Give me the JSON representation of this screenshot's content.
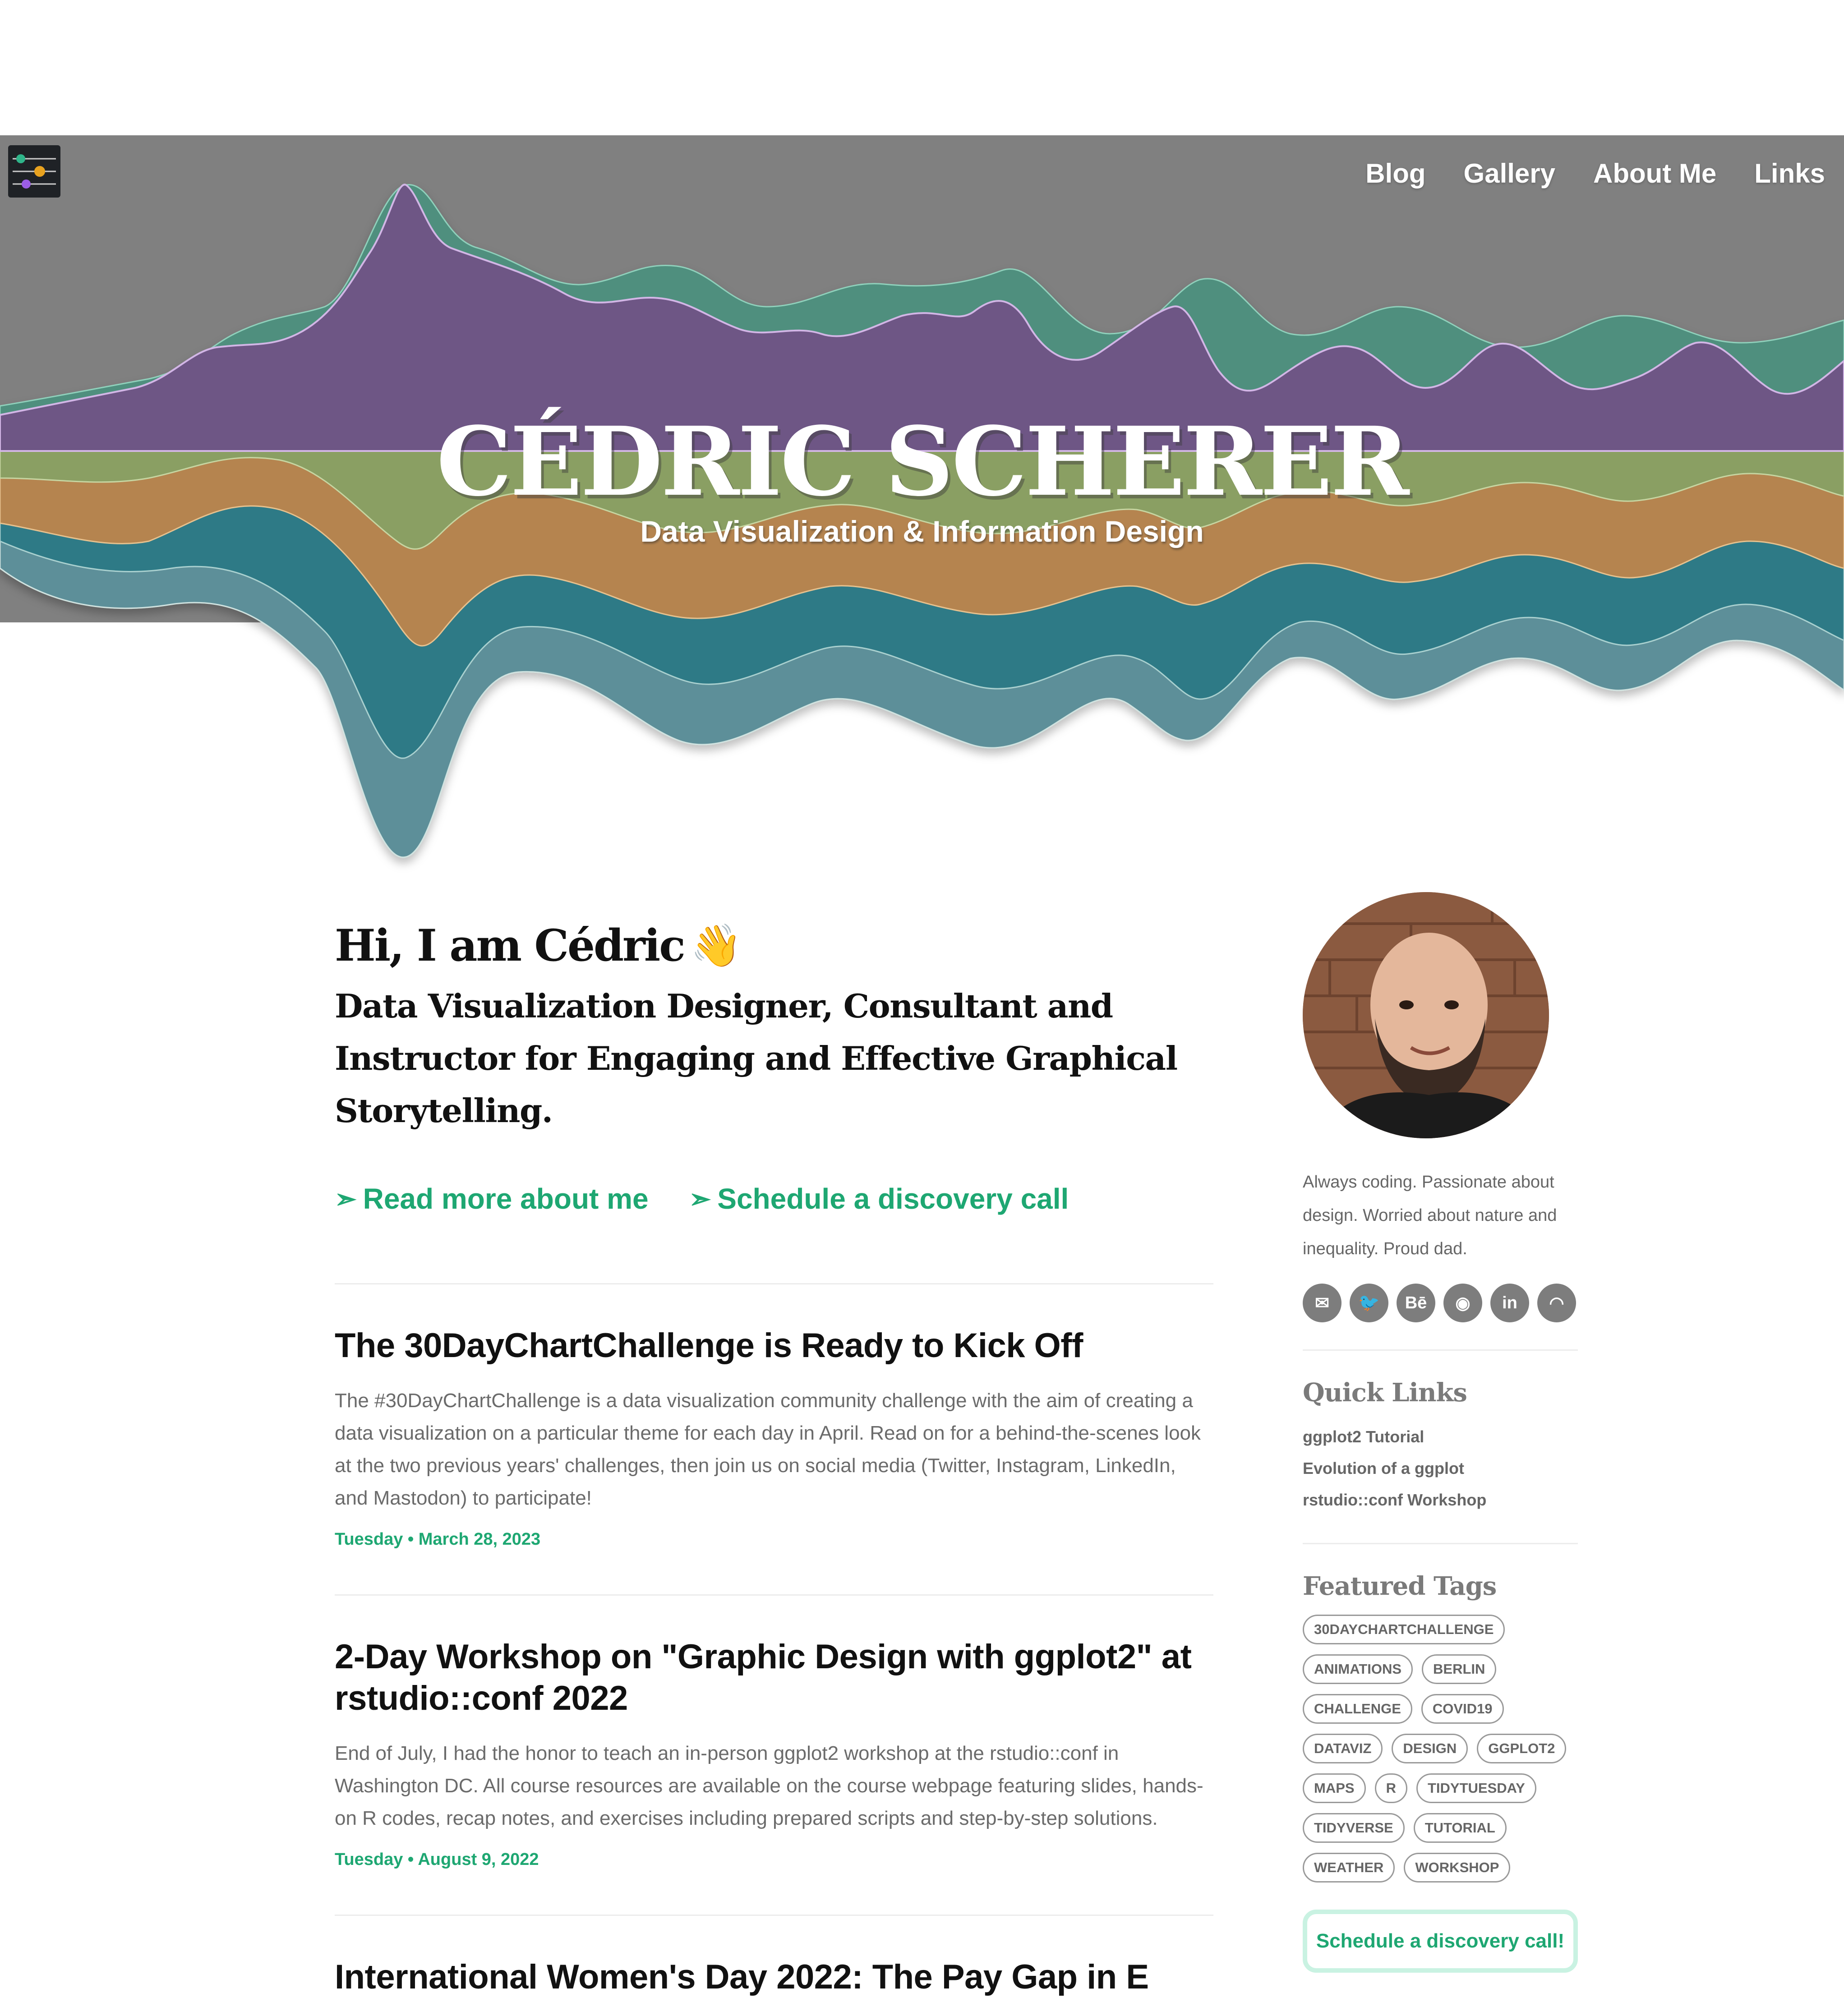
{
  "nav": {
    "items": [
      "Blog",
      "Gallery",
      "About Me",
      "Links"
    ]
  },
  "hero": {
    "title": "CÉDRIC SCHERER",
    "subtitle": "Data Visualization & Information Design"
  },
  "intro": {
    "greeting": "Hi, I am Cédric",
    "wave_icon": "👋",
    "tagline": "Data Visualization Designer, Consultant and Instructor for Engaging and Effective Graphical Storytelling.",
    "cta_read_more": "Read more about me",
    "cta_schedule": "Schedule a discovery call",
    "cta_arrow": "➣"
  },
  "posts": [
    {
      "title": "The 30DayChartChallenge is Ready to Kick Off",
      "excerpt": "The #30DayChartChallenge is a data visualization community challenge with the aim of creating a data visualization on a particular theme for each day in April. Read on for a behind-the-scenes look at the two previous years' challenges, then join us on social media (Twitter, Instagram, LinkedIn, and Mastodon) to participate!",
      "date": "Tuesday • March 28, 2023"
    },
    {
      "title": "2-Day Workshop on \"Graphic Design with ggplot2\" at rstudio::conf 2022",
      "excerpt": "End of July, I had the honor to teach an in-person ggplot2 workshop at the rstudio::conf in Washington DC. All course resources are available on the course webpage featuring slides, hands-on R codes, recap notes, and exercises including prepared scripts and step-by-step solutions.",
      "date": "Tuesday • August 9, 2022"
    },
    {
      "title": "International Women's Day 2022: The Pay Gap in E"
    }
  ],
  "sidebar": {
    "bio": "Always coding. Passionate about design. Worried about nature and inequality. Proud dad.",
    "socials": [
      {
        "icon": "email-icon",
        "glyph": "✉"
      },
      {
        "icon": "twitter-icon",
        "glyph": "🐦"
      },
      {
        "icon": "behance-icon",
        "glyph": "Bē"
      },
      {
        "icon": "github-icon",
        "glyph": "◉"
      },
      {
        "icon": "linkedin-icon",
        "glyph": "in"
      },
      {
        "icon": "rss-icon",
        "glyph": "◠"
      }
    ],
    "quick_links_title": "Quick Links",
    "quick_links": [
      "ggplot2 Tutorial",
      "Evolution of a ggplot",
      "rstudio::conf Workshop"
    ],
    "featured_tags_title": "Featured Tags",
    "tags": [
      "30DAYCHARTCHALLENGE",
      "ANIMATIONS",
      "BERLIN",
      "CHALLENGE",
      "COVID19",
      "DATAVIZ",
      "DESIGN",
      "GGPLOT2",
      "MAPS",
      "R",
      "TIDYTUESDAY",
      "TIDYVERSE",
      "TUTORIAL",
      "WEATHER",
      "WORKSHOP"
    ],
    "discovery_button": "Schedule a discovery call!"
  }
}
